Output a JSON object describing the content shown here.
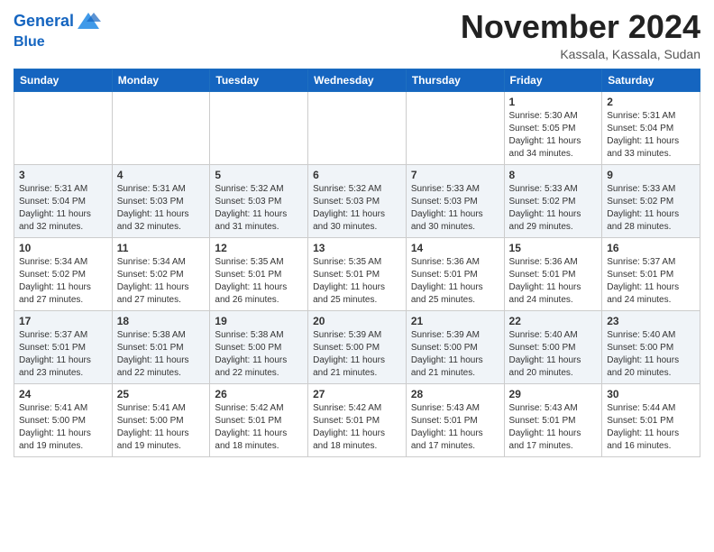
{
  "header": {
    "logo_line1": "General",
    "logo_line2": "Blue",
    "month": "November 2024",
    "location": "Kassala, Kassala, Sudan"
  },
  "weekdays": [
    "Sunday",
    "Monday",
    "Tuesday",
    "Wednesday",
    "Thursday",
    "Friday",
    "Saturday"
  ],
  "weeks": [
    [
      {
        "day": "",
        "info": ""
      },
      {
        "day": "",
        "info": ""
      },
      {
        "day": "",
        "info": ""
      },
      {
        "day": "",
        "info": ""
      },
      {
        "day": "",
        "info": ""
      },
      {
        "day": "1",
        "info": "Sunrise: 5:30 AM\nSunset: 5:05 PM\nDaylight: 11 hours\nand 34 minutes."
      },
      {
        "day": "2",
        "info": "Sunrise: 5:31 AM\nSunset: 5:04 PM\nDaylight: 11 hours\nand 33 minutes."
      }
    ],
    [
      {
        "day": "3",
        "info": "Sunrise: 5:31 AM\nSunset: 5:04 PM\nDaylight: 11 hours\nand 32 minutes."
      },
      {
        "day": "4",
        "info": "Sunrise: 5:31 AM\nSunset: 5:03 PM\nDaylight: 11 hours\nand 32 minutes."
      },
      {
        "day": "5",
        "info": "Sunrise: 5:32 AM\nSunset: 5:03 PM\nDaylight: 11 hours\nand 31 minutes."
      },
      {
        "day": "6",
        "info": "Sunrise: 5:32 AM\nSunset: 5:03 PM\nDaylight: 11 hours\nand 30 minutes."
      },
      {
        "day": "7",
        "info": "Sunrise: 5:33 AM\nSunset: 5:03 PM\nDaylight: 11 hours\nand 30 minutes."
      },
      {
        "day": "8",
        "info": "Sunrise: 5:33 AM\nSunset: 5:02 PM\nDaylight: 11 hours\nand 29 minutes."
      },
      {
        "day": "9",
        "info": "Sunrise: 5:33 AM\nSunset: 5:02 PM\nDaylight: 11 hours\nand 28 minutes."
      }
    ],
    [
      {
        "day": "10",
        "info": "Sunrise: 5:34 AM\nSunset: 5:02 PM\nDaylight: 11 hours\nand 27 minutes."
      },
      {
        "day": "11",
        "info": "Sunrise: 5:34 AM\nSunset: 5:02 PM\nDaylight: 11 hours\nand 27 minutes."
      },
      {
        "day": "12",
        "info": "Sunrise: 5:35 AM\nSunset: 5:01 PM\nDaylight: 11 hours\nand 26 minutes."
      },
      {
        "day": "13",
        "info": "Sunrise: 5:35 AM\nSunset: 5:01 PM\nDaylight: 11 hours\nand 25 minutes."
      },
      {
        "day": "14",
        "info": "Sunrise: 5:36 AM\nSunset: 5:01 PM\nDaylight: 11 hours\nand 25 minutes."
      },
      {
        "day": "15",
        "info": "Sunrise: 5:36 AM\nSunset: 5:01 PM\nDaylight: 11 hours\nand 24 minutes."
      },
      {
        "day": "16",
        "info": "Sunrise: 5:37 AM\nSunset: 5:01 PM\nDaylight: 11 hours\nand 24 minutes."
      }
    ],
    [
      {
        "day": "17",
        "info": "Sunrise: 5:37 AM\nSunset: 5:01 PM\nDaylight: 11 hours\nand 23 minutes."
      },
      {
        "day": "18",
        "info": "Sunrise: 5:38 AM\nSunset: 5:01 PM\nDaylight: 11 hours\nand 22 minutes."
      },
      {
        "day": "19",
        "info": "Sunrise: 5:38 AM\nSunset: 5:00 PM\nDaylight: 11 hours\nand 22 minutes."
      },
      {
        "day": "20",
        "info": "Sunrise: 5:39 AM\nSunset: 5:00 PM\nDaylight: 11 hours\nand 21 minutes."
      },
      {
        "day": "21",
        "info": "Sunrise: 5:39 AM\nSunset: 5:00 PM\nDaylight: 11 hours\nand 21 minutes."
      },
      {
        "day": "22",
        "info": "Sunrise: 5:40 AM\nSunset: 5:00 PM\nDaylight: 11 hours\nand 20 minutes."
      },
      {
        "day": "23",
        "info": "Sunrise: 5:40 AM\nSunset: 5:00 PM\nDaylight: 11 hours\nand 20 minutes."
      }
    ],
    [
      {
        "day": "24",
        "info": "Sunrise: 5:41 AM\nSunset: 5:00 PM\nDaylight: 11 hours\nand 19 minutes."
      },
      {
        "day": "25",
        "info": "Sunrise: 5:41 AM\nSunset: 5:00 PM\nDaylight: 11 hours\nand 19 minutes."
      },
      {
        "day": "26",
        "info": "Sunrise: 5:42 AM\nSunset: 5:01 PM\nDaylight: 11 hours\nand 18 minutes."
      },
      {
        "day": "27",
        "info": "Sunrise: 5:42 AM\nSunset: 5:01 PM\nDaylight: 11 hours\nand 18 minutes."
      },
      {
        "day": "28",
        "info": "Sunrise: 5:43 AM\nSunset: 5:01 PM\nDaylight: 11 hours\nand 17 minutes."
      },
      {
        "day": "29",
        "info": "Sunrise: 5:43 AM\nSunset: 5:01 PM\nDaylight: 11 hours\nand 17 minutes."
      },
      {
        "day": "30",
        "info": "Sunrise: 5:44 AM\nSunset: 5:01 PM\nDaylight: 11 hours\nand 16 minutes."
      }
    ]
  ]
}
